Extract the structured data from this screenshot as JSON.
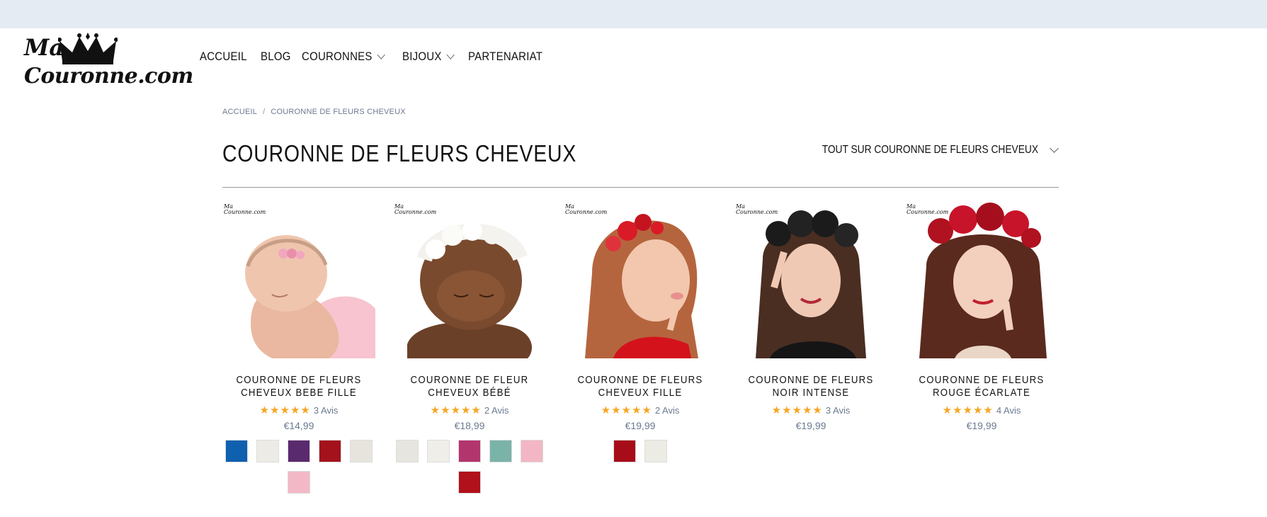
{
  "header": {
    "logo_line1": "Ma",
    "logo_line2": "Couronne.com"
  },
  "nav": {
    "items": [
      {
        "label": "ACCUEIL",
        "dropdown": false
      },
      {
        "label": "BLOG",
        "dropdown": false
      },
      {
        "label": "COURONNES",
        "dropdown": true
      },
      {
        "label": "BIJOUX",
        "dropdown": true
      },
      {
        "label": "PARTENARIAT",
        "dropdown": false
      }
    ]
  },
  "breadcrumb": {
    "home": "ACCUEIL",
    "separator": "/",
    "current": "COURONNE DE FLEURS CHEVEUX"
  },
  "page": {
    "title": "COURONNE DE FLEURS CHEVEUX",
    "sort_label": "TOUT SUR COURONNE DE FLEURS CHEVEUX"
  },
  "products": [
    {
      "title_line1": "COURONNE DE FLEURS",
      "title_line2": "CHEVEUX BEBE FILLE",
      "stars": "★★★★★",
      "reviews": "3 Avis",
      "price": "€14,99",
      "swatches": [
        "#1060b0",
        "#ecebe5",
        "#5a2a6e",
        "#a4121c",
        "#e6e4dc",
        "#f2b8c6"
      ]
    },
    {
      "title_line1": "COURONNE DE FLEUR",
      "title_line2": "CHEVEUX BÉBÉ",
      "stars": "★★★★★",
      "reviews": "2 Avis",
      "price": "€18,99",
      "swatches": [
        "#e7e5df",
        "#efeee8",
        "#b3356e",
        "#7ab3a8",
        "#f3b6c4",
        "#b0111a"
      ]
    },
    {
      "title_line1": "COURONNE DE FLEURS",
      "title_line2": "CHEVEUX FILLE",
      "stars": "★★★★★",
      "reviews": "2 Avis",
      "price": "€19,99",
      "swatches": [
        "#a70d18",
        "#ecebe4"
      ]
    },
    {
      "title_line1": "COURONNE DE FLEURS",
      "title_line2": "NOIR INTENSE",
      "stars": "★★★★★",
      "reviews": "3 Avis",
      "price": "€19,99",
      "swatches": []
    },
    {
      "title_line1": "COURONNE DE FLEURS",
      "title_line2": "ROUGE ÉCARLATE",
      "stars": "★★★★★",
      "reviews": "4 Avis",
      "price": "€19,99",
      "swatches": []
    }
  ],
  "colors": {
    "topbar": "#e4ebf3",
    "star": "#f5a623",
    "muted_text": "#6b7a90"
  },
  "icons": [
    "crown-logo-icon",
    "chevron-down-icon"
  ]
}
